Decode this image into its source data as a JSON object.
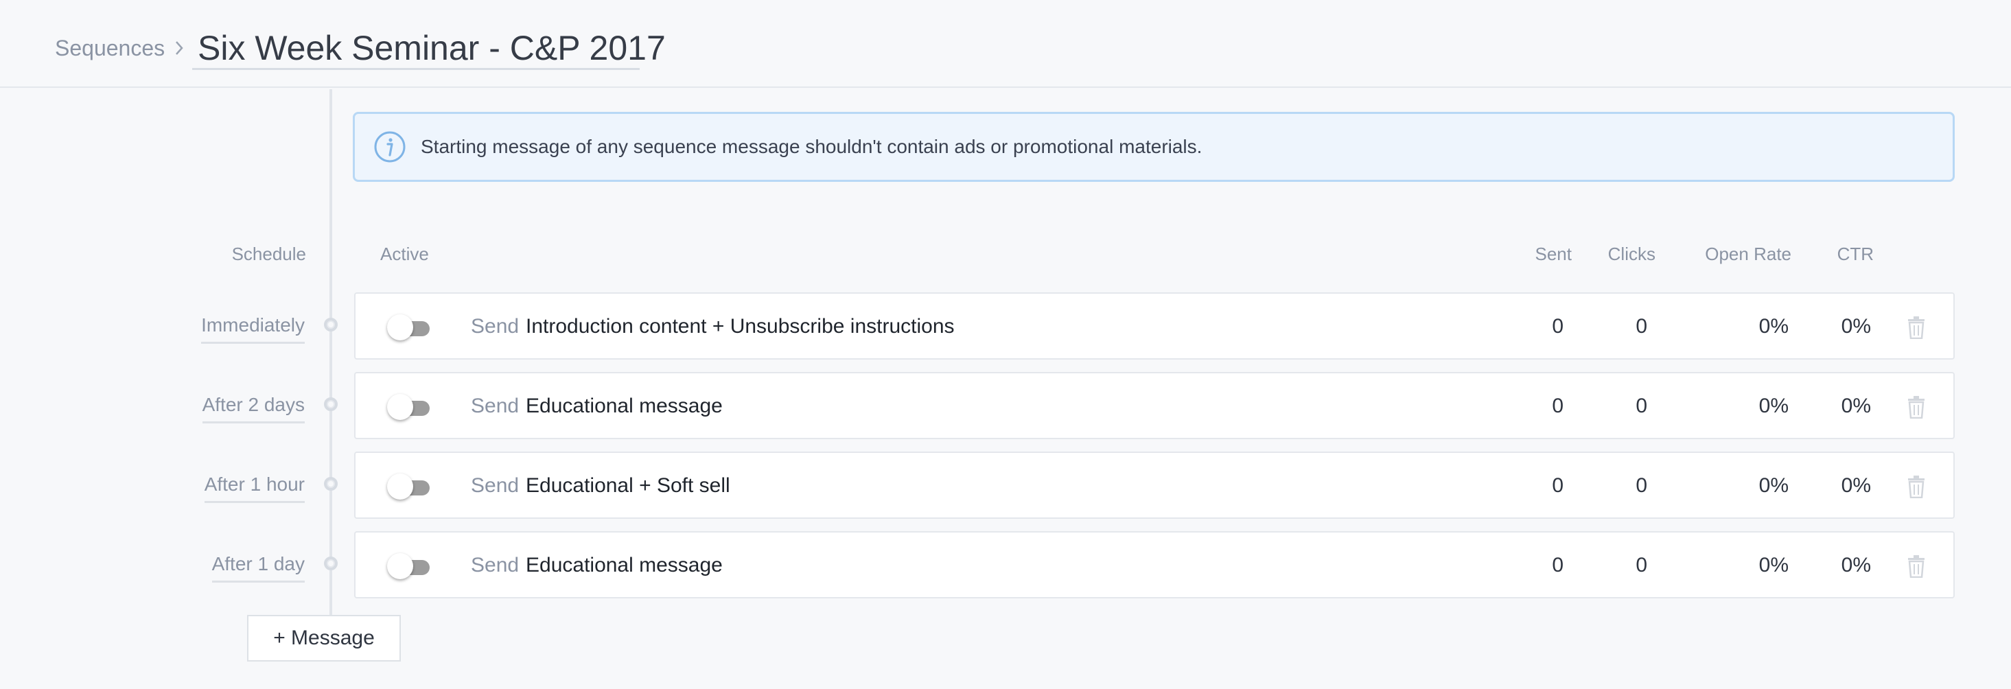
{
  "header": {
    "breadcrumb_root": "Sequences",
    "title": "Six Week Seminar - C&P 2017"
  },
  "info_banner": {
    "icon": "info-icon",
    "text": "Starting message of any sequence message shouldn't contain ads or promotional materials."
  },
  "columns": {
    "schedule": "Schedule",
    "active": "Active",
    "sent": "Sent",
    "clicks": "Clicks",
    "open_rate": "Open Rate",
    "ctr": "CTR"
  },
  "send_label": "Send",
  "messages": [
    {
      "schedule": "Immediately",
      "title": "Introduction content + Unsubscribe instructions",
      "sent": "0",
      "clicks": "0",
      "open_rate": "0%",
      "ctr": "0%",
      "active": false
    },
    {
      "schedule": "After 2 days",
      "title": "Educational message",
      "sent": "0",
      "clicks": "0",
      "open_rate": "0%",
      "ctr": "0%",
      "active": false
    },
    {
      "schedule": "After 1 hour",
      "title": "Educational + Soft sell",
      "sent": "0",
      "clicks": "0",
      "open_rate": "0%",
      "ctr": "0%",
      "active": false
    },
    {
      "schedule": "After 1 day",
      "title": "Educational message",
      "sent": "0",
      "clicks": "0",
      "open_rate": "0%",
      "ctr": "0%",
      "active": false
    }
  ],
  "add_message_label": "+ Message",
  "colors": {
    "banner_border": "#b8d8f5",
    "banner_bg": "#eef5fd",
    "info_icon": "#7fb4e6",
    "toggle_off_track": "#9c9c9c",
    "muted_text": "#8a93a3"
  }
}
